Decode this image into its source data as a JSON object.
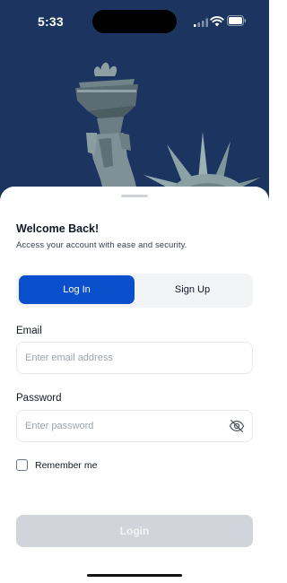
{
  "status_bar": {
    "time": "5:33"
  },
  "hero": {
    "image": "statue-of-liberty-torch-and-crown"
  },
  "sheet": {
    "title": "Welcome Back!",
    "subtitle": "Access your account with ease and security."
  },
  "tabs": [
    {
      "label": "Log In",
      "active": true
    },
    {
      "label": "Sign Up",
      "active": false
    }
  ],
  "form": {
    "email_label": "Email",
    "email_placeholder": "Enter email address",
    "email_value": "",
    "password_label": "Password",
    "password_placeholder": "Enter password",
    "password_value": "",
    "password_toggle_icon": "eye-off-icon",
    "remember_label": "Remember me",
    "remember_checked": false,
    "submit_label": "Login",
    "submit_enabled": false
  },
  "colors": {
    "hero_bg": "#1c3560",
    "primary": "#0a50cc",
    "button_disabled": "#d1d5db"
  }
}
